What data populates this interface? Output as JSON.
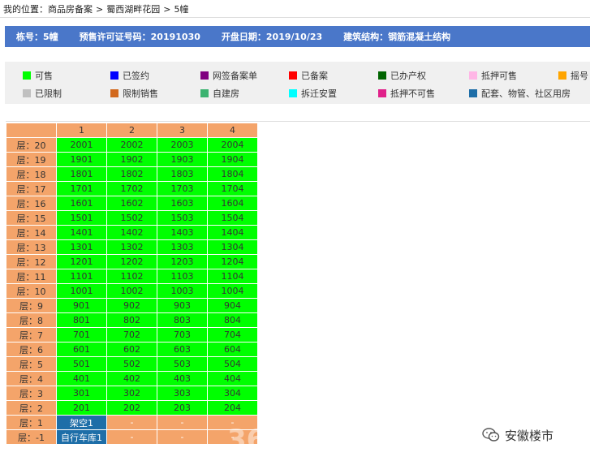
{
  "breadcrumb": {
    "prefix": "我的位置：",
    "items": [
      "商品房备案",
      "蜀西湖畔花园",
      "5幢"
    ],
    "separator": ">"
  },
  "info": [
    {
      "label": "栋号：",
      "value": "5幢"
    },
    {
      "label": "预售许可证号码：",
      "value": "20191030"
    },
    {
      "label": "开盘日期：",
      "value": "2019/10/23"
    },
    {
      "label": "建筑结构：",
      "value": "钢筋混凝土结构"
    }
  ],
  "legend": [
    {
      "label": "可售",
      "color": "#00ff00"
    },
    {
      "label": "已签约",
      "color": "#0000ff"
    },
    {
      "label": "网签备案单",
      "color": "#800080"
    },
    {
      "label": "已备案",
      "color": "#ff0000"
    },
    {
      "label": "已办产权",
      "color": "#006400"
    },
    {
      "label": "抵押可售",
      "color": "#ffb6e6"
    },
    {
      "label": "摇号",
      "color": "#ffa500"
    },
    {
      "label": "已限制",
      "color": "#c0c0c0"
    },
    {
      "label": "限制销售",
      "color": "#d2691e"
    },
    {
      "label": "自建房",
      "color": "#3cb371"
    },
    {
      "label": "拆迁安置",
      "color": "#00ffff"
    },
    {
      "label": "抵押不可售",
      "color": "#e0218a"
    },
    {
      "label": "配套、物管、社区用房",
      "color": "#1e6ea8"
    }
  ],
  "grid": {
    "columns": [
      "1",
      "2",
      "3",
      "4"
    ],
    "rows": [
      {
        "floor": "层：20",
        "units": [
          "2001",
          "2002",
          "2003",
          "2004"
        ]
      },
      {
        "floor": "层：19",
        "units": [
          "1901",
          "1902",
          "1903",
          "1904"
        ]
      },
      {
        "floor": "层：18",
        "units": [
          "1801",
          "1802",
          "1803",
          "1804"
        ]
      },
      {
        "floor": "层：17",
        "units": [
          "1701",
          "1702",
          "1703",
          "1704"
        ]
      },
      {
        "floor": "层：16",
        "units": [
          "1601",
          "1602",
          "1603",
          "1604"
        ]
      },
      {
        "floor": "层：15",
        "units": [
          "1501",
          "1502",
          "1503",
          "1504"
        ]
      },
      {
        "floor": "层：14",
        "units": [
          "1401",
          "1402",
          "1403",
          "1404"
        ]
      },
      {
        "floor": "层：13",
        "units": [
          "1301",
          "1302",
          "1303",
          "1304"
        ]
      },
      {
        "floor": "层：12",
        "units": [
          "1201",
          "1202",
          "1203",
          "1204"
        ]
      },
      {
        "floor": "层：11",
        "units": [
          "1101",
          "1102",
          "1103",
          "1104"
        ]
      },
      {
        "floor": "层：10",
        "units": [
          "1001",
          "1002",
          "1003",
          "1004"
        ]
      },
      {
        "floor": "层：9",
        "units": [
          "901",
          "902",
          "903",
          "904"
        ]
      },
      {
        "floor": "层：8",
        "units": [
          "801",
          "802",
          "803",
          "804"
        ]
      },
      {
        "floor": "层：7",
        "units": [
          "701",
          "702",
          "703",
          "704"
        ]
      },
      {
        "floor": "层：6",
        "units": [
          "601",
          "602",
          "603",
          "604"
        ]
      },
      {
        "floor": "层：5",
        "units": [
          "501",
          "502",
          "503",
          "504"
        ]
      },
      {
        "floor": "层：4",
        "units": [
          "401",
          "402",
          "403",
          "404"
        ]
      },
      {
        "floor": "层：3",
        "units": [
          "301",
          "302",
          "303",
          "304"
        ]
      },
      {
        "floor": "层：2",
        "units": [
          "201",
          "202",
          "203",
          "204"
        ]
      },
      {
        "floor": "层：1",
        "units": [
          "架空1",
          "-",
          "-",
          "-"
        ]
      },
      {
        "floor": "层：-1",
        "units": [
          "自行车库1",
          "-",
          "-",
          "-"
        ]
      }
    ]
  },
  "watermark": {
    "text": "安徽楼市",
    "faint": "365"
  }
}
